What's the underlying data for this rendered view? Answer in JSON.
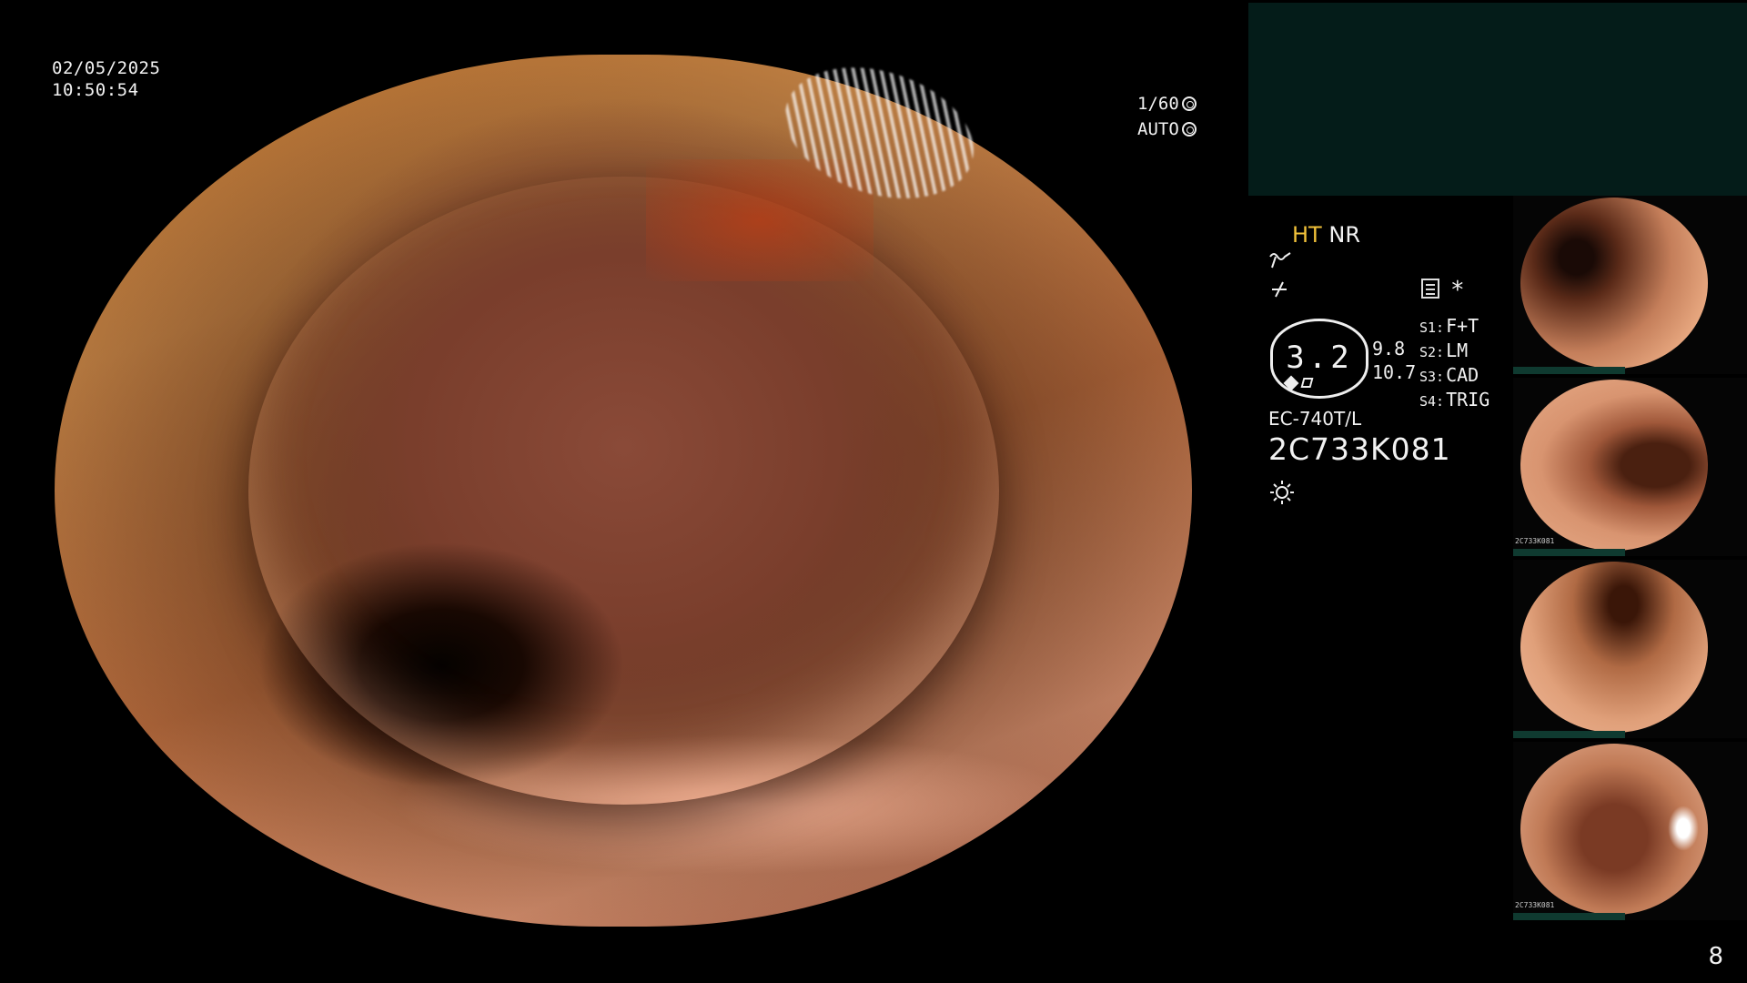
{
  "overlay": {
    "date": "02/05/2025",
    "time": "10:50:54",
    "shutter": "1/60",
    "iris": "AUTO"
  },
  "side_panel": {
    "mode_ht": "HT",
    "mode_nr": "NR",
    "zoom_value": "3.2",
    "zoom_a": "9.8",
    "zoom_b": "10.7",
    "scope_model": "EC-740T/L",
    "serial": "2C733K081",
    "switches": [
      {
        "key": "S1:",
        "value": "F+T"
      },
      {
        "key": "S2:",
        "value": "LM"
      },
      {
        "key": "S3:",
        "value": "CAD"
      },
      {
        "key": "S4:",
        "value": "TRIG"
      }
    ],
    "star": "*"
  },
  "thumbnail_label": "2C733K081",
  "page_number": "8",
  "colors": {
    "mode_ht": "#f2c23a",
    "teal_panel": "#041c19"
  }
}
